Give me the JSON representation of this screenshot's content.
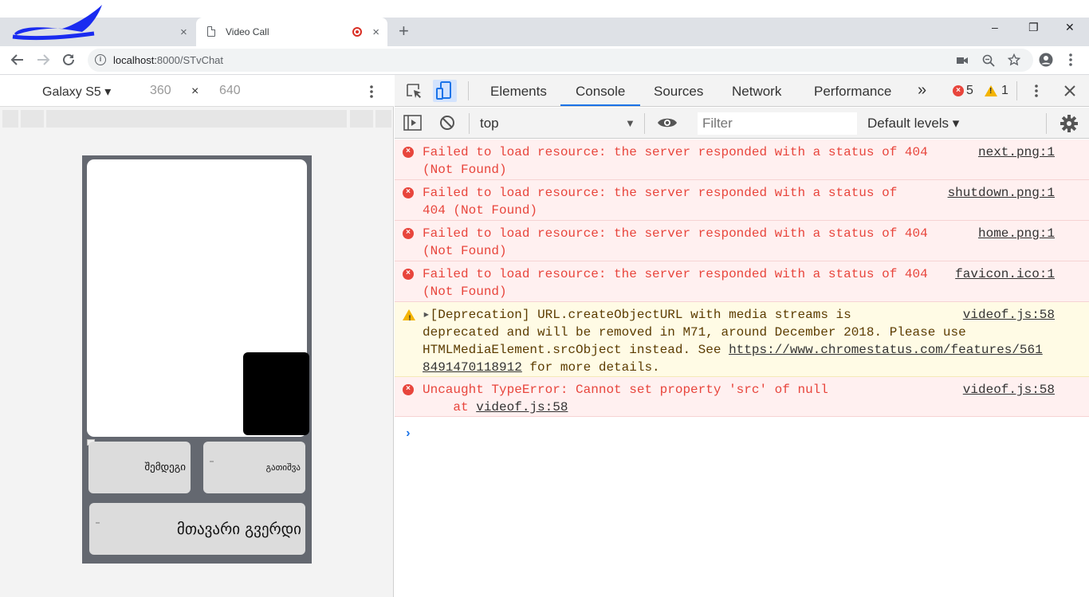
{
  "browser": {
    "tabs": [
      {
        "title": "",
        "close": "×"
      },
      {
        "title": "Video Call",
        "close": "×"
      }
    ],
    "new_tab": "+",
    "window_controls": {
      "minimize": "–",
      "restore": "❐",
      "close": "✕"
    },
    "url_host": "localhost:",
    "url_rest": "8000/STvChat"
  },
  "device_toolbar": {
    "model": "Galaxy S5",
    "width": "360",
    "times": "×",
    "height": "640"
  },
  "app": {
    "next_label": "შემდეგი",
    "shutdown_label": "გათიშვა",
    "home_label": "მთავარი გვერდი"
  },
  "devtools": {
    "tabs": [
      "Elements",
      "Console",
      "Sources",
      "Network",
      "Performance"
    ],
    "more": "»",
    "error_count": "5",
    "warning_count": "1",
    "context": "top",
    "filter_placeholder": "Filter",
    "levels": "Default levels",
    "messages": [
      {
        "level": "error",
        "text": "Failed to load resource: the server responded with a status of 404\n(Not Found)",
        "source": "next.png:1"
      },
      {
        "level": "error",
        "text": "Failed to load resource: the server responded with a status of\n404 (Not Found)",
        "source": "shutdown.png:1"
      },
      {
        "level": "error",
        "text": "Failed to load resource: the server responded with a status of 404\n(Not Found)",
        "source": "home.png:1"
      },
      {
        "level": "error",
        "text": "Failed to load resource: the server responded with a status of 404\n(Not Found)",
        "source": "favicon.ico:1"
      },
      {
        "level": "warning",
        "line1": "[Deprecation] URL.createObjectURL with media streams is",
        "line2": "deprecated and will be removed in M71, around December 2018. Please use",
        "line3_pre": "HTMLMediaElement.srcObject instead. See ",
        "link_a": "https://www.chromestatus.com/features/561",
        "link_b": "8491470118912",
        "line4_post": " for more details.",
        "source": "videof.js:58"
      },
      {
        "level": "error",
        "text": "Uncaught TypeError: Cannot set property 'src' of null",
        "at": "    at ",
        "at_link": "videof.js:58",
        "source": "videof.js:58"
      }
    ],
    "prompt": "›"
  }
}
